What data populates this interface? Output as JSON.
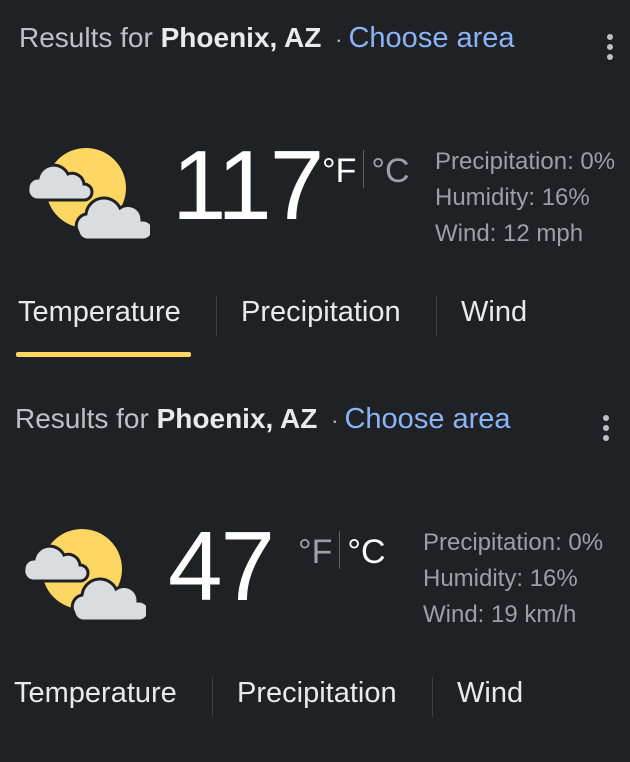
{
  "colors": {
    "background": "#202124",
    "link": "#8ab4f8",
    "accent": "#fdd663",
    "text": "#bdc1c6"
  },
  "widgets": [
    {
      "results_prefix": "Results for",
      "location": "Phoenix, AZ",
      "separator": "·",
      "choose_area": "Choose area",
      "icon": "partly-cloudy-icon",
      "temperature": "117",
      "unit_f": "°F",
      "unit_c": "°C",
      "active_unit": "F",
      "precipitation": "Precipitation: 0%",
      "humidity": "Humidity: 16%",
      "wind": "Wind: 12 mph",
      "tabs": [
        "Temperature",
        "Precipitation",
        "Wind"
      ],
      "selected_tab": "Temperature"
    },
    {
      "results_prefix": "Results for",
      "location": "Phoenix, AZ",
      "separator": "·",
      "choose_area": "Choose area",
      "icon": "partly-cloudy-icon",
      "temperature": "47",
      "unit_f": "°F",
      "unit_c": "°C",
      "active_unit": "C",
      "precipitation": "Precipitation: 0%",
      "humidity": "Humidity: 16%",
      "wind": "Wind: 19 km/h",
      "tabs": [
        "Temperature",
        "Precipitation",
        "Wind"
      ],
      "selected_tab": null
    }
  ]
}
